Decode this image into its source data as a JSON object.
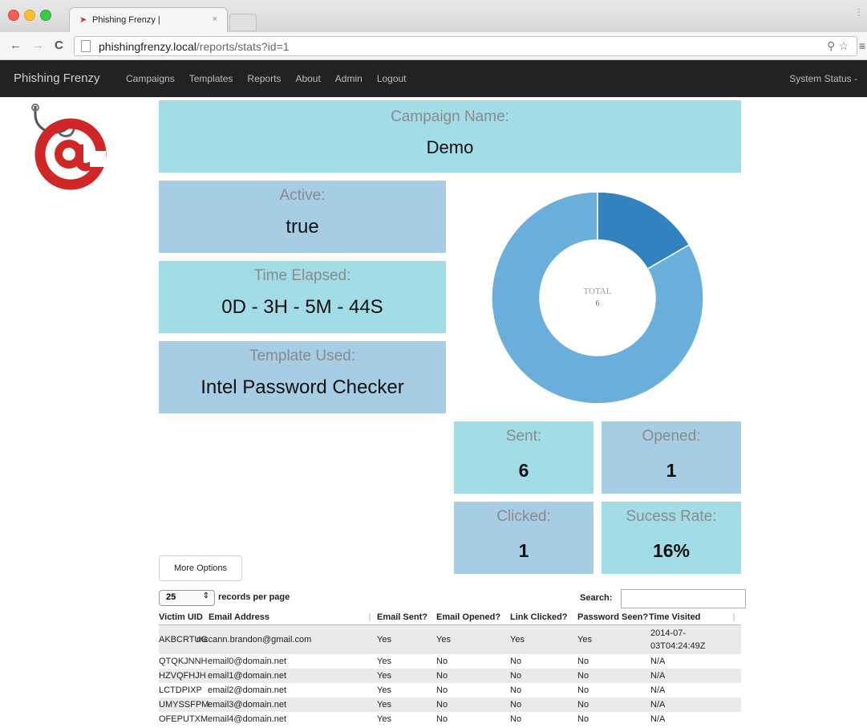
{
  "browser": {
    "tab_title": "Phishing Frenzy |",
    "tab_close": "×",
    "url_host": "phishingfrenzy.local",
    "url_path": "/reports/stats?id=1"
  },
  "navbar": {
    "brand": "Phishing Frenzy",
    "links": [
      "Campaigns",
      "Templates",
      "Reports",
      "About",
      "Admin",
      "Logout"
    ],
    "system_status": "System Status -"
  },
  "campaign": {
    "label": "Campaign Name:",
    "value": "Demo"
  },
  "active": {
    "label": "Active:",
    "value": "true"
  },
  "elapsed": {
    "label": "Time Elapsed:",
    "value": "0D - 3H - 5M - 44S"
  },
  "template": {
    "label": "Template Used:",
    "value": "Intel Password Checker"
  },
  "stats": {
    "sent": {
      "label": "Sent:",
      "value": "6"
    },
    "opened": {
      "label": "Opened:",
      "value": "1"
    },
    "clicked": {
      "label": "Clicked:",
      "value": "1"
    },
    "rate": {
      "label": "Sucess Rate:",
      "value": "16%"
    }
  },
  "donut": {
    "center_label": "TOTAL",
    "center_value": "6",
    "colors": {
      "minor": "#3282bf",
      "major": "#6aaedb"
    }
  },
  "chart_data": {
    "type": "pie",
    "categories": [
      "",
      ""
    ],
    "values": [
      1,
      5
    ]
  },
  "table_controls": {
    "more_options": "More Options",
    "per_page_value": "25",
    "per_page_label": "records per page",
    "search_label": "Search:"
  },
  "table": {
    "headers": [
      "Victim UID",
      "Email Address",
      "Email Sent?",
      "Email Opened?",
      "Link Clicked?",
      "Password Seen?",
      "Time Visited"
    ],
    "rows": [
      [
        "AKBCRTUG",
        "mccann.brandon@gmail.com",
        "Yes",
        "Yes",
        "Yes",
        "Yes",
        "2014-07-03T04:24:49Z"
      ],
      [
        "QTQKJNNH",
        "email0@domain.net",
        "Yes",
        "No",
        "No",
        "No",
        "N/A"
      ],
      [
        "HZVQFHJH",
        "email1@domain.net",
        "Yes",
        "No",
        "No",
        "No",
        "N/A"
      ],
      [
        "LCTDPIXP",
        "email2@domain.net",
        "Yes",
        "No",
        "No",
        "No",
        "N/A"
      ],
      [
        "UMYSSFPM",
        "email3@domain.net",
        "Yes",
        "No",
        "No",
        "No",
        "N/A"
      ],
      [
        "OFEPUTXM",
        "email4@domain.net",
        "Yes",
        "No",
        "No",
        "No",
        "N/A"
      ]
    ]
  }
}
